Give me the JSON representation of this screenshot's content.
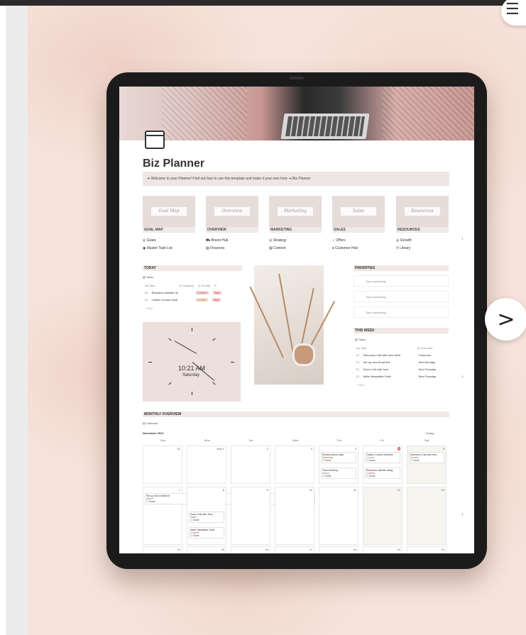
{
  "planner": {
    "title": "Biz Planner",
    "banner": "➜  Welcome to your Planner! Find out how to use this template and make it your own here ➜  Biz Planner",
    "cards": [
      {
        "label": "GOAL MAP",
        "link1": "◎ Goals",
        "link2": "◉ Master Task List"
      },
      {
        "label": "OVERVIEW",
        "link1": "⛟ Brand Hub",
        "link2": "▤ Finances"
      },
      {
        "label": "MARKETING",
        "link1": "◎ Strategy",
        "link2": "▤ Content"
      },
      {
        "label": "SALES",
        "link1": "♀ Offers",
        "link2": "♦ Customer Hub"
      },
      {
        "label": "RESOURCES",
        "link1": "◎ Growth",
        "link2": "⚲ Library"
      }
    ],
    "today": {
      "heading": "TODAY",
      "view": "▤ Tasks",
      "columns": [
        "Aa Task",
        "◎ Category",
        "◎ Priority",
        "⚲"
      ],
      "rows": [
        {
          "task": "Research website de",
          "category": "Content",
          "priority": "High"
        },
        {
          "task": "Outline Course Modi",
          "category": "Course",
          "priority": "High"
        }
      ],
      "new": "+ New"
    },
    "clock": {
      "time": "10:21 AM",
      "day": "Saturday"
    },
    "priorities": {
      "heading": "PRIORITIES",
      "items": [
        "Type something...",
        "Type something...",
        "Type something..."
      ]
    },
    "this_week": {
      "heading": "THIS WEEK",
      "view": "▤ Tasks",
      "columns": [
        "Aa Task",
        "◎ Due Date"
      ],
      "rows": [
        {
          "task": "Discovery Call with new client",
          "due": "Tomorrow"
        },
        {
          "task": "Set up new Email bot",
          "due": "Next Monday"
        },
        {
          "task": "Zoom Call with Jess",
          "due": "Next Tuesday"
        },
        {
          "task": "Write Newsletter Draft",
          "due": "Next Tuesday"
        }
      ],
      "new": "+ New"
    },
    "monthly": {
      "heading": "MONTHLY OVERVIEW",
      "view": "▤ Calendar",
      "month": "November 2022",
      "today_btn": "‹  Today  ›",
      "days": [
        "Sun",
        "Mon",
        "Tue",
        "Wed",
        "Thu",
        "Fri",
        "Sat"
      ],
      "week1_nums": [
        "31",
        "Nov 1",
        "2",
        "3",
        "4",
        "5",
        "6"
      ],
      "week2_nums": [
        "7",
        "8",
        "9",
        "10",
        "11",
        "12",
        "13"
      ],
      "week3_nums": [
        "14",
        "15",
        "16",
        "17",
        "18",
        "19",
        "20"
      ],
      "events": {
        "thu1": {
          "title": "Review launch plan",
          "tag": "Marketing",
          "done": "☐ Done"
        },
        "thu2": {
          "title": "Team Meeting",
          "tag": "Admin",
          "done": "☐ Done"
        },
        "fri1": {
          "title": "Outline Course Modules",
          "tag": "Course",
          "done": "☐ Done"
        },
        "fri2": {
          "title": "Research website desig",
          "tag": "Content",
          "done": "☐ Done"
        },
        "sat1": {
          "title": "Discovery Call with new...",
          "tag": "Service",
          "done": "☐ Done"
        },
        "sun2": {
          "title": "Set up new Email bot",
          "tag": "Admin",
          "done": "☐ Done"
        },
        "tue2a": {
          "title": "Zoom Call with Jess",
          "tag": "Sales",
          "done": "☐ Done"
        },
        "tue2b": {
          "title": "Write Newsletter Draft",
          "tag": "Content",
          "done": "☐ Done"
        }
      }
    }
  },
  "nav": {
    "next_icon": ">",
    "top_icon": "☰"
  }
}
